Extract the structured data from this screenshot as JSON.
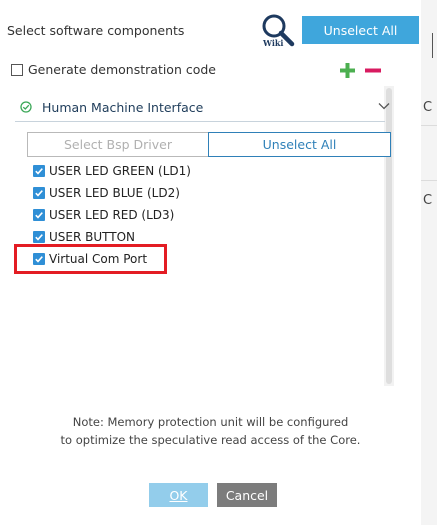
{
  "header": {
    "title": "Select software components",
    "wiki_text": "Wiki",
    "unselect_all_label": "Unselect All"
  },
  "demo": {
    "label": "Generate demonstration code",
    "checked": false
  },
  "section": {
    "label": "Human Machine Interface",
    "select_bsp_label": "Select Bsp Driver",
    "unselect_all_label": "Unselect All",
    "items": [
      {
        "label": "USER LED GREEN (LD1)",
        "checked": true
      },
      {
        "label": "USER LED BLUE (LD2)",
        "checked": true
      },
      {
        "label": "USER LED RED (LD3)",
        "checked": true
      },
      {
        "label": "USER BUTTON",
        "checked": true
      },
      {
        "label": "Virtual Com Port",
        "checked": true
      }
    ]
  },
  "note": {
    "line1": "Note: Memory protection unit will be configured",
    "line2": "to optimize the speculative read access of the Core."
  },
  "footer": {
    "ok_label": "OK",
    "cancel_label": "Cancel"
  },
  "background": {
    "fragment_1": "C",
    "fragment_2": "C"
  },
  "colors": {
    "primary": "#3fa6dc",
    "check_blue": "#2f8fd6",
    "highlight_red": "#e31c23",
    "plus_green": "#4caf50",
    "minus_magenta": "#d81b60",
    "cancel_gray": "#7c7c7c"
  },
  "icons": {
    "wiki": "wiki-magnifier-icon",
    "add": "plus-icon",
    "remove": "minus-icon",
    "section_check": "check-circle-icon",
    "collapse": "chevron-down-icon",
    "checkbox": "checkmark-icon"
  }
}
